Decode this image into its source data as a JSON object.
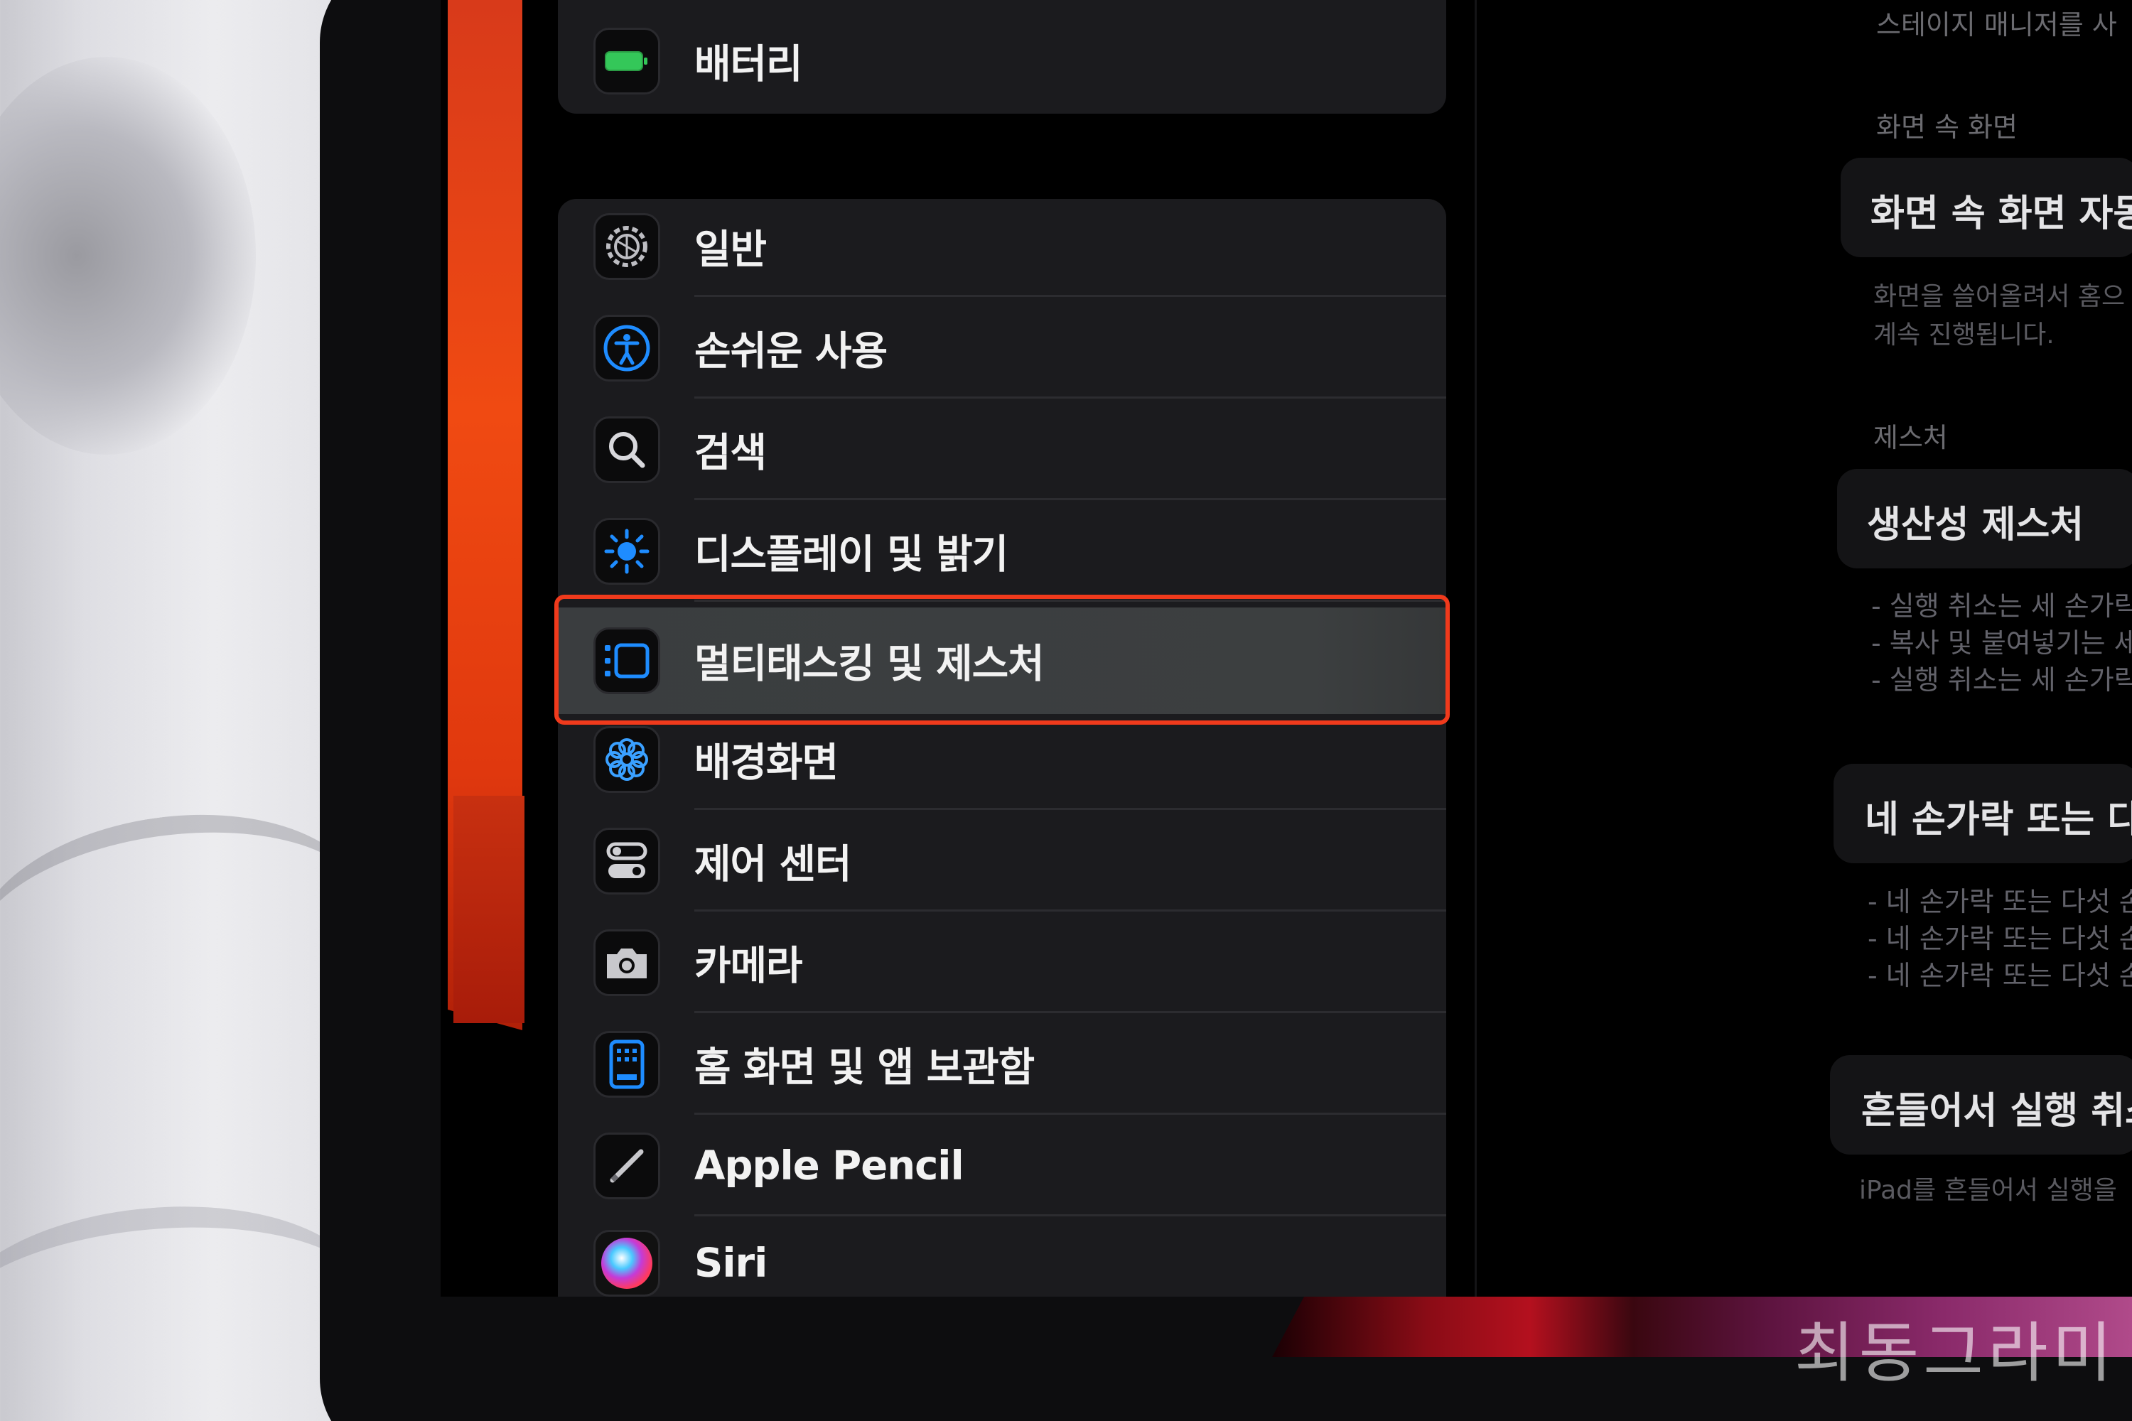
{
  "settings": {
    "battery": {
      "label": "배터리",
      "icon": "battery-icon"
    },
    "items": [
      {
        "label": "일반",
        "icon": "gear-icon"
      },
      {
        "label": "손쉬운 사용",
        "icon": "accessibility-icon"
      },
      {
        "label": "검색",
        "icon": "search-icon"
      },
      {
        "label": "디스플레이 및 밝기",
        "icon": "brightness-icon"
      },
      {
        "label": "멀티태스킹 및 제스처",
        "icon": "multitasking-icon",
        "selected": true
      },
      {
        "label": "배경화면",
        "icon": "wallpaper-flower-icon"
      },
      {
        "label": "제어 센터",
        "icon": "control-center-icon"
      },
      {
        "label": "카메라",
        "icon": "camera-icon"
      },
      {
        "label": "홈 화면 및 앱 보관함",
        "icon": "home-screen-icon"
      },
      {
        "label": "Apple Pencil",
        "icon": "pencil-icon"
      },
      {
        "label": "Siri",
        "icon": "siri-icon"
      }
    ]
  },
  "detail": {
    "stage_manager_caption": "스테이지 매니저를 사",
    "pip_section": "화면 속 화면",
    "pip_card_title": "화면 속 화면 자동",
    "pip_desc_1": "화면을 쓸어올려서 홈으",
    "pip_desc_2": "계속 진행됩니다.",
    "gesture_section": "제스처",
    "productivity_title": "생산성 제스처",
    "productivity_bullets": [
      "- 실행 취소는 세 손가락",
      "- 복사 및 붙여넣기는 세",
      "- 실행 취소는 세 손가락"
    ],
    "four_finger_title": "네 손가락 또는 다",
    "four_finger_bullets": [
      "- 네 손가락 또는 다섯 손",
      "- 네 손가락 또는 다섯 손",
      "- 네 손가락 또는 다섯 손"
    ],
    "shake_title": "흔들어서 실행 취소",
    "shake_desc": "iPad를 흔들어서 실행을"
  },
  "watermark": "최동그라미",
  "colors": {
    "highlight": "#f03a1c",
    "accent_blue": "#1e8cff",
    "battery_green": "#34c759",
    "wallpaper_orange": "#f04a12"
  }
}
